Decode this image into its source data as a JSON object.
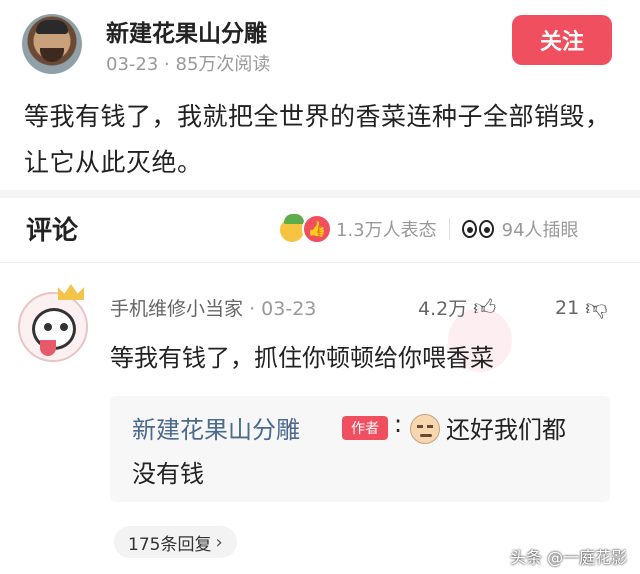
{
  "post": {
    "author": "新建花果山分雕",
    "date": "03-23",
    "views": "85万次阅读",
    "follow_label": "关注",
    "content": "等我有钱了，我就把全世界的香菜连种子全部销毁，让它从此灭绝。"
  },
  "comments_bar": {
    "title": "评论",
    "reaction_icon": "thumbs-up-icon",
    "reactions": "1.3万人表态",
    "eyes_count": "94人插眼"
  },
  "comment": {
    "user": "手机维修小当家",
    "date": "03-23",
    "likes": "4.2万",
    "dislikes": "21",
    "text": "等我有钱了，抓住你顿顿给你喂香菜",
    "reply": {
      "user": "新建花果山分雕",
      "tag": "作者",
      "colon": ":",
      "line1": "还好我们都",
      "line2": "没有钱"
    },
    "replies_label": "175条回复"
  },
  "watermark_text": "头条 @一庭花影",
  "colors": {
    "accent": "#f04f5f",
    "reply_name": "#4b6a8e",
    "muted": "#999999"
  }
}
